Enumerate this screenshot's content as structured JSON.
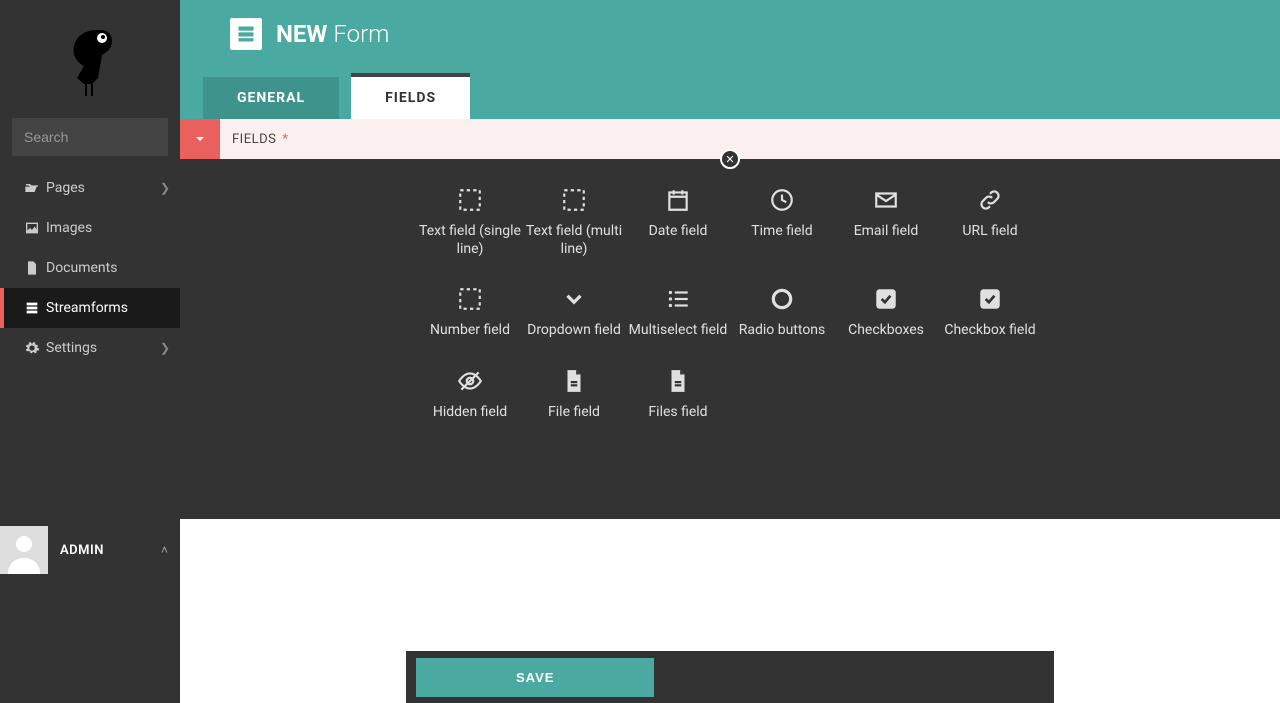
{
  "sidebar": {
    "search_placeholder": "Search",
    "nav": [
      {
        "label": "Pages",
        "icon": "folder-open-icon",
        "has_children": true
      },
      {
        "label": "Images",
        "icon": "image-icon",
        "has_children": false
      },
      {
        "label": "Documents",
        "icon": "document-icon",
        "has_children": false
      },
      {
        "label": "Streamforms",
        "icon": "form-icon",
        "has_children": false,
        "active": true
      },
      {
        "label": "Settings",
        "icon": "gear-icon",
        "has_children": true
      }
    ],
    "user": {
      "name": "ADMIN"
    }
  },
  "header": {
    "title_bold": "NEW",
    "title_thin": "Form",
    "tabs": {
      "general": "GENERAL",
      "fields": "FIELDS"
    },
    "active_tab": "fields"
  },
  "fields_section": {
    "toggle_open": true,
    "label": "FIELDS",
    "required": true
  },
  "field_types": [
    {
      "id": "text-single",
      "label": "Text field (single line)",
      "icon": "placeholder-icon"
    },
    {
      "id": "text-multi",
      "label": "Text field (multi line)",
      "icon": "placeholder-icon"
    },
    {
      "id": "date",
      "label": "Date field",
      "icon": "calendar-icon"
    },
    {
      "id": "time",
      "label": "Time field",
      "icon": "clock-icon"
    },
    {
      "id": "email",
      "label": "Email field",
      "icon": "envelope-icon"
    },
    {
      "id": "url",
      "label": "URL field",
      "icon": "link-icon"
    },
    {
      "id": "number",
      "label": "Number field",
      "icon": "placeholder-icon"
    },
    {
      "id": "dropdown",
      "label": "Dropdown field",
      "icon": "chevron-down-icon"
    },
    {
      "id": "multiselect",
      "label": "Multiselect field",
      "icon": "list-ul-icon"
    },
    {
      "id": "radio",
      "label": "Radio buttons",
      "icon": "radio-icon"
    },
    {
      "id": "checkboxes",
      "label": "Checkboxes",
      "icon": "check-square-icon"
    },
    {
      "id": "checkbox",
      "label": "Checkbox field",
      "icon": "check-square-icon"
    },
    {
      "id": "hidden",
      "label": "Hidden field",
      "icon": "eye-slash-icon"
    },
    {
      "id": "file",
      "label": "File field",
      "icon": "file-icon"
    },
    {
      "id": "files",
      "label": "Files field",
      "icon": "file-icon"
    }
  ],
  "footer": {
    "save_label": "SAVE"
  },
  "colors": {
    "accent": "#4aa9a0",
    "danger": "#e9605c",
    "sidebar_bg": "#333333"
  }
}
